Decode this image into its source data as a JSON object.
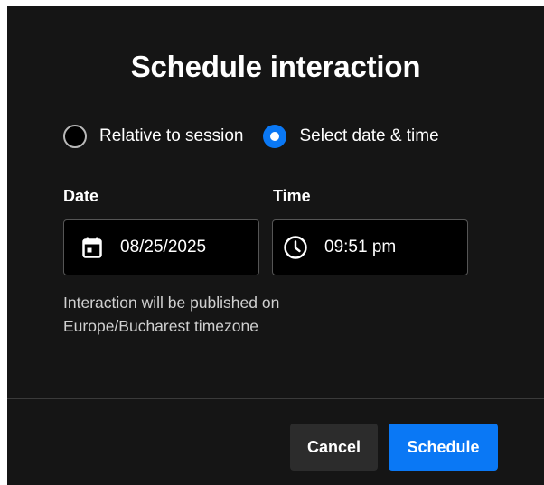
{
  "dialog": {
    "title": "Schedule interaction",
    "radio_options": [
      {
        "label": "Relative to session",
        "selected": false
      },
      {
        "label": "Select date & time",
        "selected": true
      }
    ],
    "date": {
      "label": "Date",
      "value": "08/25/2025",
      "icon": "calendar-icon"
    },
    "time": {
      "label": "Time",
      "value": "09:51 pm",
      "icon": "clock-icon"
    },
    "hint": "Interaction will be published on Europe/Bucharest timezone",
    "buttons": {
      "cancel_label": "Cancel",
      "schedule_label": "Schedule"
    },
    "colors": {
      "background": "#151515",
      "accent": "#0a78f5",
      "secondary_button": "#2c2c2c"
    }
  }
}
